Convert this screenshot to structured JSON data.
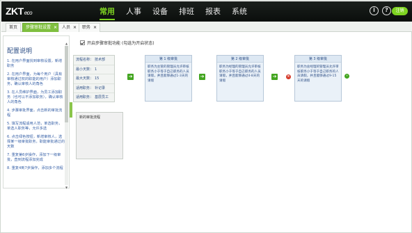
{
  "header": {
    "logo_main": "ZKT",
    "logo_eco": "eco",
    "nav": [
      "常用",
      "人事",
      "设备",
      "排班",
      "报表",
      "系统"
    ],
    "active_nav": 0,
    "icons": [
      "info-icon",
      "help-icon"
    ],
    "user_label": "注销"
  },
  "tabs": [
    {
      "label": "首页",
      "closable": false,
      "active": false
    },
    {
      "label": "步骤审批设置",
      "closable": true,
      "active": true
    },
    {
      "label": "人员",
      "closable": true,
      "active": false
    },
    {
      "label": "职务",
      "closable": true,
      "active": false
    }
  ],
  "sidebar": {
    "title": "配置说明",
    "items": [
      "1. 在用户界面找到审核设置，新增职务",
      "2. 在用户界面，为每个用户（具有审核通过权的职能的用户）添加职务，确认审核人的角色",
      "3. 在人员维护界面，为员工添加职务（也可以不添加职务），确认审核人的角色",
      "4. 步骤审批界面，点击新的审批流程",
      "5. 填写流程适用人范，单选职务，单选人职务等，允许多选",
      "6. 点击绿色按钮，新增审核人，选择某一级审批职务，职能审批通过的天数",
      "7. 重复第6步操作，添加下一级审批，直到流程添加完成",
      "8. 重复4到7步操作，添加多个流程"
    ]
  },
  "content": {
    "enable_label": "开启步骤审批功能 (勾选为开启状态)",
    "enabled": true,
    "info": [
      {
        "key": "流程名称：",
        "value": "技术部"
      },
      {
        "key": "最小天数：",
        "value": "1"
      },
      {
        "key": "最大天数：",
        "value": "15"
      },
      {
        "key": "适用职务：",
        "value": "补记录"
      },
      {
        "key": "适用职务：",
        "value": "基层员工"
      }
    ],
    "steps": [
      {
        "title": "第 1 级审批",
        "body": "职务为主管的管理员允许审核职务小于等于自己职务的人员请假，并且能够通过1-3天的请假"
      },
      {
        "title": "第 2 级审批",
        "body": "职务为经理的管理员允许审核职务小于等于自己职务的人员请假，并且能够通过4-8天的请假"
      },
      {
        "title": "第 3 级审批",
        "body": "职务为总经理的管理员允许审核职务小于等于自己职务的人员请假，并且能够通过9-15天的请假"
      }
    ],
    "new_flow_label": "新的审批流程",
    "colors": {
      "accent": "#7ed321",
      "tab_active": "#7fbf3f",
      "link": "#3a63a8",
      "delete": "#d53a2a"
    }
  }
}
